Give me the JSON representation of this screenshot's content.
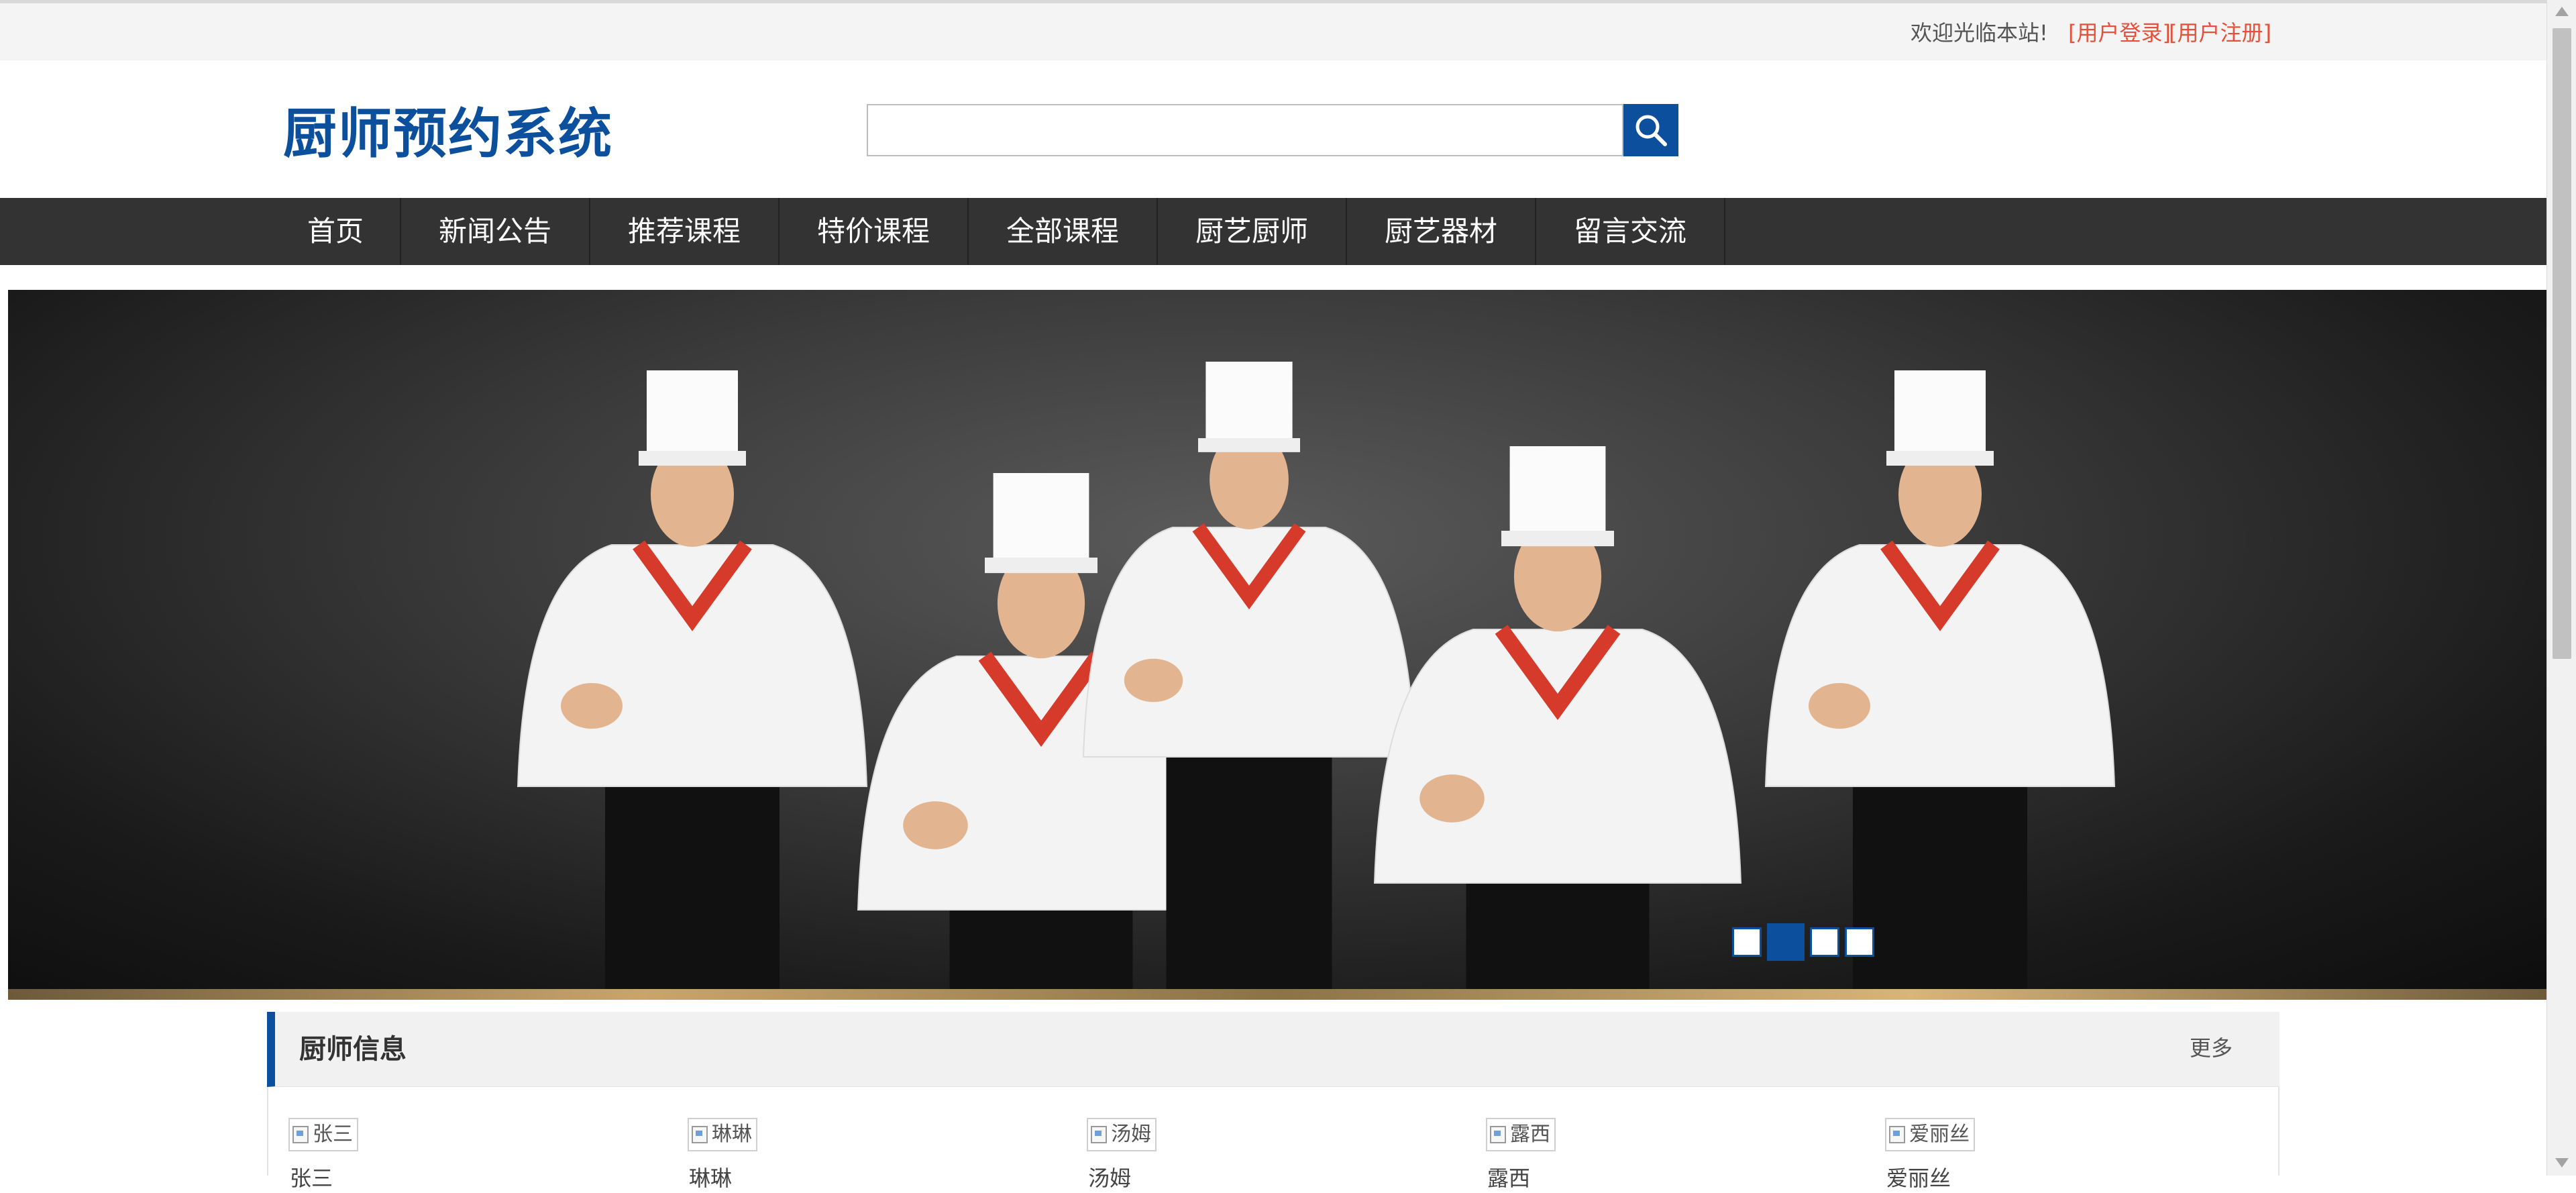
{
  "topbar": {
    "welcome_text": "欢迎光临本站!",
    "login_link": "[用户登录]",
    "register_link": "[用户注册]"
  },
  "header": {
    "site_title": "厨师预约系统",
    "search": {
      "value": "",
      "placeholder": ""
    }
  },
  "nav": {
    "items": [
      {
        "label": "首页"
      },
      {
        "label": "新闻公告"
      },
      {
        "label": "推荐课程"
      },
      {
        "label": "特价课程"
      },
      {
        "label": "全部课程"
      },
      {
        "label": "厨艺厨师"
      },
      {
        "label": "厨艺器材"
      },
      {
        "label": "留言交流"
      }
    ]
  },
  "banner": {
    "slide_count": 4,
    "active_index": 1
  },
  "chef_section": {
    "title": "厨师信息",
    "more_label": "更多",
    "chefs": [
      {
        "alt": "张三",
        "name": "张三"
      },
      {
        "alt": "琳琳",
        "name": "琳琳"
      },
      {
        "alt": "汤姆",
        "name": "汤姆"
      },
      {
        "alt": "露西",
        "name": "露西"
      },
      {
        "alt": "爱丽丝",
        "name": "爱丽丝"
      }
    ]
  },
  "colors": {
    "brand_blue": "#0c4f9c",
    "nav_bg": "#333333",
    "link_red": "#e4513a"
  },
  "icons": {
    "search": "search-icon",
    "broken_image": "broken-image-icon"
  }
}
